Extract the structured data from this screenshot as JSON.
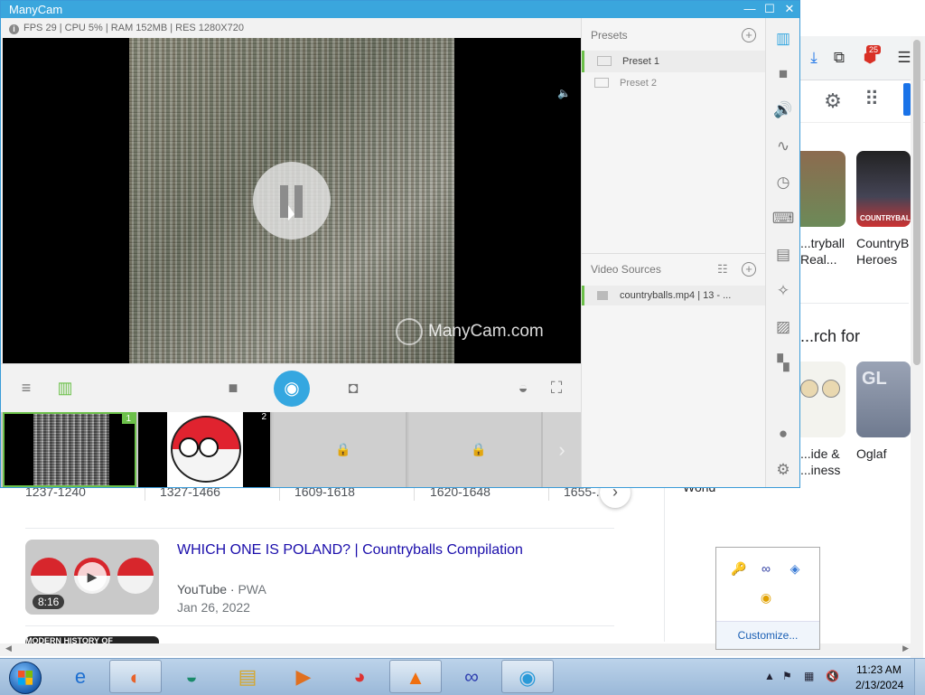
{
  "manycam": {
    "title": "ManyCam",
    "window_controls": {
      "minimize": "—",
      "maximize": "☐",
      "close": "✕"
    },
    "stats": "FPS 29 | CPU 5% | RAM 152MB | RES 1280X720",
    "watermark": "ManyCam.com",
    "thumbnails": [
      {
        "number": "1",
        "state": "active"
      },
      {
        "number": "2",
        "state": "image"
      },
      {
        "state": "locked"
      },
      {
        "state": "locked"
      }
    ],
    "presets": {
      "header": "Presets",
      "items": [
        {
          "label": "Preset 1",
          "active": true
        },
        {
          "label": "Preset 2",
          "active": false
        }
      ]
    },
    "video_sources": {
      "header": "Video Sources",
      "items": [
        {
          "label": "countryballs.mp4 | 13 - ..."
        }
      ]
    },
    "sidebar_icons": [
      "presets-icon",
      "camera-icon",
      "audio-icon",
      "draw-icon",
      "clock-icon",
      "keyboard-icon",
      "lower-thirds-icon",
      "effects-icon",
      "images-icon",
      "widgets-icon",
      "account-icon",
      "settings-icon"
    ],
    "accent_color": "#3aa6dd",
    "active_color": "#6cc04a"
  },
  "browser": {
    "cards": [
      {
        "title": "...tryball\nReal..."
      },
      {
        "title": "CountryB\nHeroes"
      }
    ],
    "search_for_heading": "...rch for",
    "search_cards": [
      {
        "title": "...ide &\n...iness"
      },
      {
        "title": "Oglaf"
      }
    ],
    "badge_count": "25",
    "ranges": [
      "1237-1240",
      "1327-1466",
      "1609-1618",
      "1620-1648",
      "1655-..."
    ],
    "world_text": "World",
    "video": {
      "title": "WHICH ONE IS POLAND? | Countryballs Compilation",
      "source": "YouTube",
      "source_suffix": "PWA",
      "date": "Jan 26, 2022",
      "duration": "8:16",
      "next_thumb_text": "MODERN HISTORY OF"
    }
  },
  "tray_popup": {
    "customize": "Customize..."
  },
  "taskbar": {
    "apps": [
      "internet-explorer-icon",
      "firefox-icon",
      "app-green-icon",
      "file-explorer-icon",
      "media-player-icon",
      "chrome-icon",
      "avast-icon",
      "infinity-app-icon",
      "manycam-icon"
    ],
    "time": "11:23 AM",
    "date": "2/13/2024"
  }
}
